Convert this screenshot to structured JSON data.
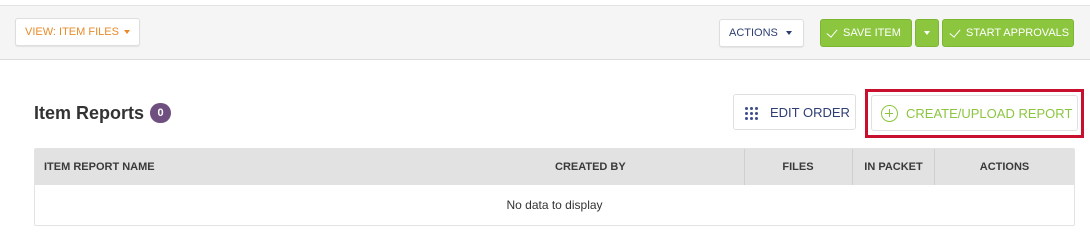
{
  "toolbar": {
    "view_label": "VIEW: ITEM FILES",
    "actions_label": "ACTIONS",
    "save_label": "SAVE ITEM",
    "start_approvals_label": "START APPROVALS"
  },
  "section": {
    "title": "Item Reports",
    "count": "0",
    "edit_order_label": "EDIT ORDER",
    "create_label": "CREATE/UPLOAD REPORT"
  },
  "table": {
    "columns": [
      "ITEM REPORT NAME",
      "CREATED BY",
      "FILES",
      "IN PACKET",
      "ACTIONS"
    ],
    "empty_message": "No data to display"
  },
  "icons": {
    "view_caret": "chevron-down-icon",
    "save_check": "check-icon",
    "edit_order": "grid-dots-icon",
    "create": "plus-circle-icon"
  },
  "colors": {
    "accent_orange": "#e98b2a",
    "navy": "#2e3d73",
    "green": "#8cc63f",
    "badge_purple": "#6f4f7f",
    "highlight_red": "#c8102e"
  }
}
